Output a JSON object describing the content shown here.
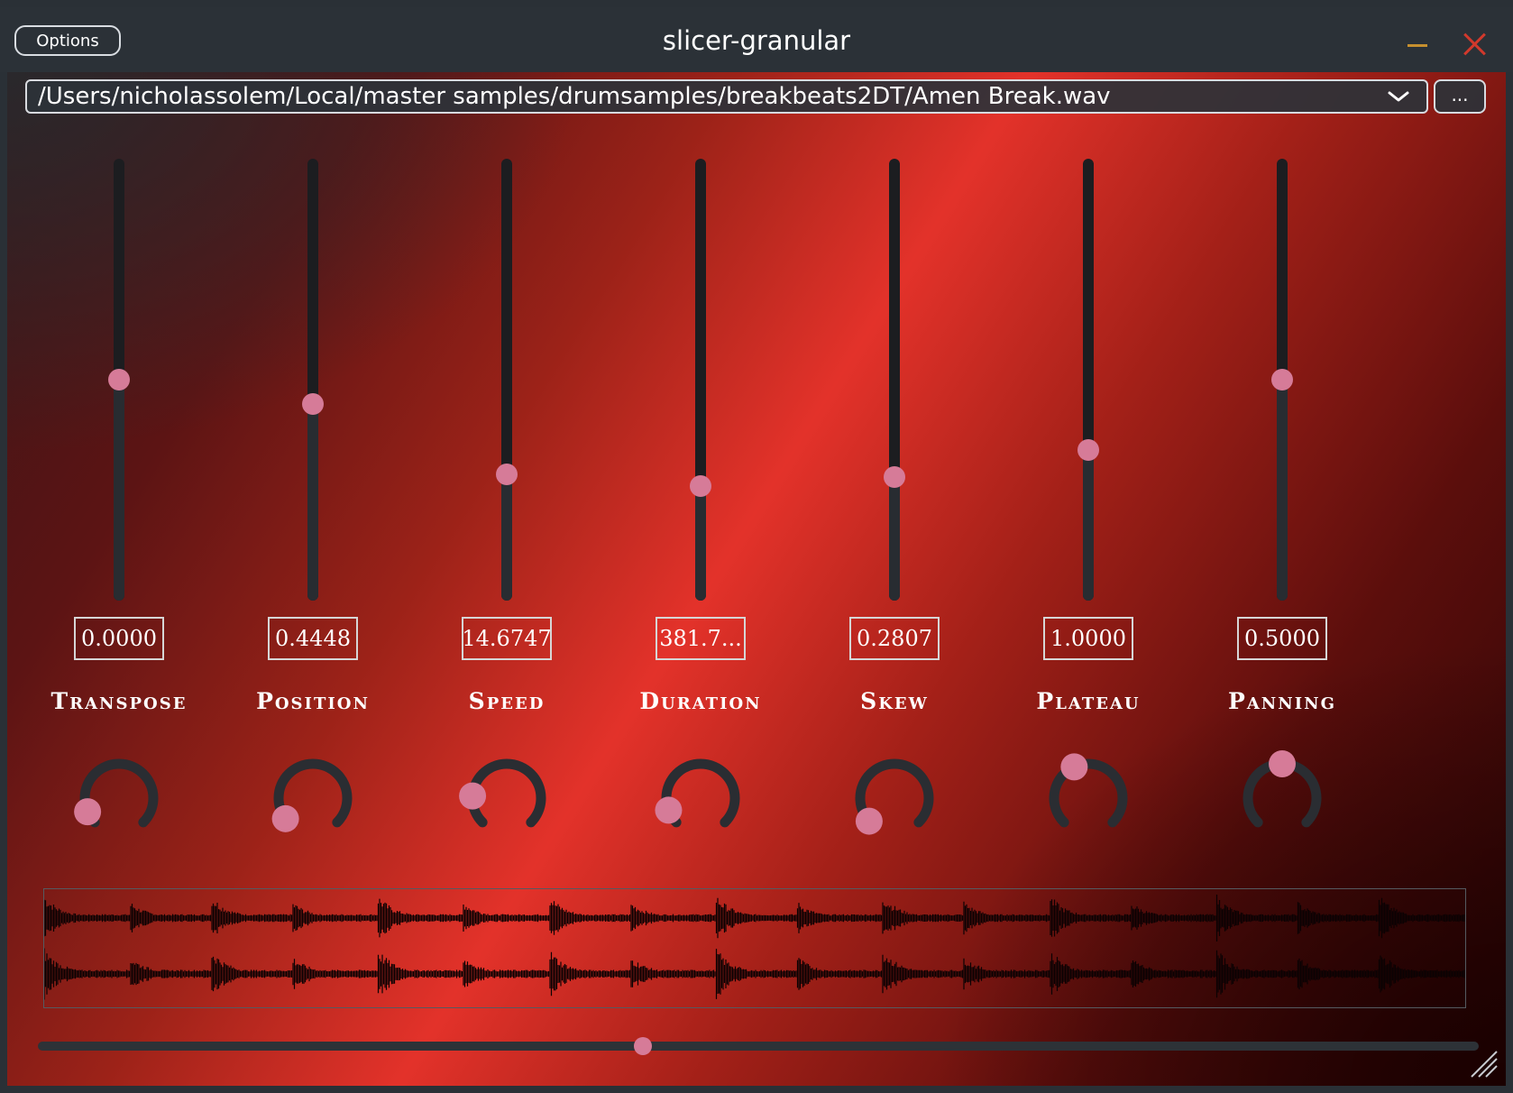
{
  "window": {
    "title": "slicer-granular",
    "options_label": "Options"
  },
  "file": {
    "path": "/Users/nicholassolem/Local/master samples/drumsamples/breakbeats2DT/Amen Break.wav",
    "browse_label": "..."
  },
  "colors": {
    "accent_thumb": "#d67b98",
    "minimize": "#c6902f",
    "close": "#d1392c"
  },
  "sliders": [
    {
      "id": "transpose",
      "label": "Transpose",
      "display": "0.0000",
      "level": 0.5,
      "knob": 0.08
    },
    {
      "id": "position",
      "label": "Position",
      "display": "0.4448",
      "level": 0.445,
      "knob": 0.03
    },
    {
      "id": "speed",
      "label": "Speed",
      "display": "14.6747",
      "level": 0.285,
      "knob": 0.18
    },
    {
      "id": "duration",
      "label": "Duration",
      "display": "381.7...",
      "level": 0.26,
      "knob": 0.09
    },
    {
      "id": "skew",
      "label": "Skew",
      "display": "0.2807",
      "level": 0.28,
      "knob": 0.01
    },
    {
      "id": "plateau",
      "label": "Plateau",
      "display": "1.0000",
      "level": 0.34,
      "knob": 0.41
    },
    {
      "id": "panning",
      "label": "Panning",
      "display": "0.5000",
      "level": 0.5,
      "knob": 0.5
    }
  ],
  "scrubber": {
    "position": 0.42
  },
  "icons": {
    "dropdown": "chevron-down-icon",
    "minimize": "minimize-icon",
    "close": "close-icon",
    "resize": "resize-grip-icon"
  }
}
